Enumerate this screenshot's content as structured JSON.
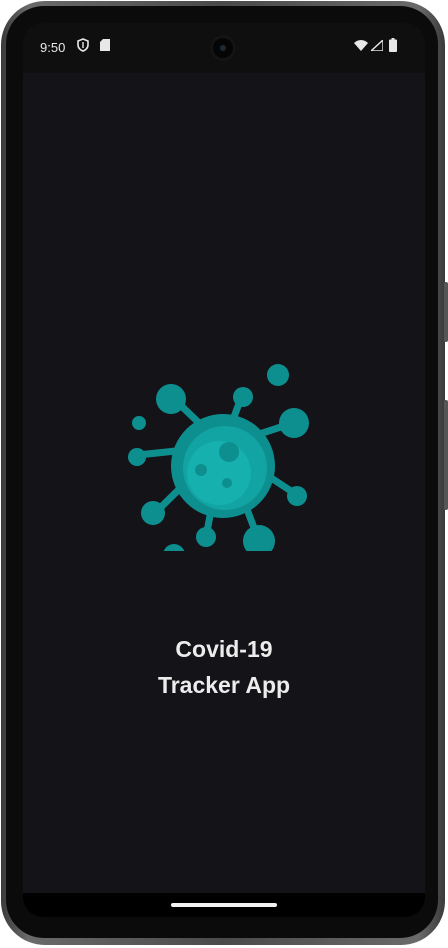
{
  "status_bar": {
    "time": "9:50",
    "icons": [
      "shield-icon",
      "sd-card-icon",
      "wifi-icon",
      "signal-icon",
      "battery-icon"
    ]
  },
  "app": {
    "title_line1": "Covid-19",
    "title_line2": "Tracker App",
    "logo_icon": "virus-icon"
  },
  "colors": {
    "background": "#141318",
    "virus_primary": "#0e8f8f",
    "virus_highlight": "#16aaaa",
    "title_text": "#ececec"
  }
}
